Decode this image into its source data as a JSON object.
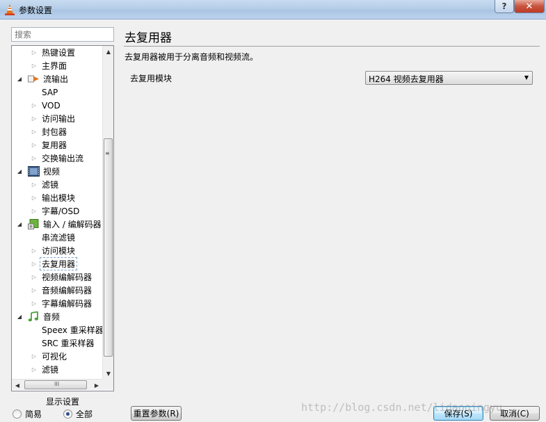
{
  "window": {
    "title": "参数设置",
    "help_label": "?",
    "close_label": "✕"
  },
  "search": {
    "placeholder": "搜索"
  },
  "tree": {
    "items": [
      {
        "label": "热键设置",
        "level": 1,
        "arrow": "collapsed"
      },
      {
        "label": "主界面",
        "level": 1,
        "arrow": "collapsed"
      },
      {
        "label": "流输出",
        "level": 0,
        "arrow": "expanded",
        "icon": "stream-output-icon"
      },
      {
        "label": "SAP",
        "level": 1,
        "arrow": "none"
      },
      {
        "label": "VOD",
        "level": 1,
        "arrow": "collapsed"
      },
      {
        "label": "访问输出",
        "level": 1,
        "arrow": "collapsed"
      },
      {
        "label": "封包器",
        "level": 1,
        "arrow": "collapsed"
      },
      {
        "label": "复用器",
        "level": 1,
        "arrow": "collapsed"
      },
      {
        "label": "交换输出流",
        "level": 1,
        "arrow": "collapsed"
      },
      {
        "label": "视频",
        "level": 0,
        "arrow": "expanded",
        "icon": "video-icon"
      },
      {
        "label": "滤镜",
        "level": 1,
        "arrow": "collapsed"
      },
      {
        "label": "输出模块",
        "level": 1,
        "arrow": "collapsed"
      },
      {
        "label": "字幕/OSD",
        "level": 1,
        "arrow": "collapsed"
      },
      {
        "label": "输入 / 编解码器",
        "level": 0,
        "arrow": "expanded",
        "icon": "input-codecs-icon"
      },
      {
        "label": "串流滤镜",
        "level": 1,
        "arrow": "none"
      },
      {
        "label": "访问模块",
        "level": 1,
        "arrow": "collapsed"
      },
      {
        "label": "去复用器",
        "level": 1,
        "arrow": "collapsed",
        "selected": true
      },
      {
        "label": "视频编解码器",
        "level": 1,
        "arrow": "collapsed"
      },
      {
        "label": "音频编解码器",
        "level": 1,
        "arrow": "collapsed"
      },
      {
        "label": "字幕编解码器",
        "level": 1,
        "arrow": "collapsed"
      },
      {
        "label": "音频",
        "level": 0,
        "arrow": "expanded",
        "icon": "audio-icon"
      },
      {
        "label": "Speex 重采样器",
        "level": 1,
        "arrow": "none"
      },
      {
        "label": "SRC 重采样器",
        "level": 1,
        "arrow": "none"
      },
      {
        "label": "可视化",
        "level": 1,
        "arrow": "collapsed"
      },
      {
        "label": "滤镜",
        "level": 1,
        "arrow": "collapsed"
      }
    ]
  },
  "scrollbar": {
    "h_grip": "III",
    "v_grip": "≡"
  },
  "show_settings": {
    "title": "显示设置",
    "options": [
      {
        "label": "简易",
        "checked": false
      },
      {
        "label": "全部",
        "checked": true
      }
    ]
  },
  "content": {
    "title": "去复用器",
    "description": "去复用器被用于分离音频和视频流。",
    "field_label": "去复用模块",
    "select_value": "H264 视频去复用器"
  },
  "buttons": {
    "reset": "重置参数(R)",
    "save": "保存(S)",
    "cancel": "取消(C)"
  },
  "watermark": "http://blog.csdn.net/lidaoqingyu",
  "colors": {
    "titlebar": "#b5cde8",
    "selection_border": "#7da2ce",
    "close_button": "#c7543f"
  }
}
